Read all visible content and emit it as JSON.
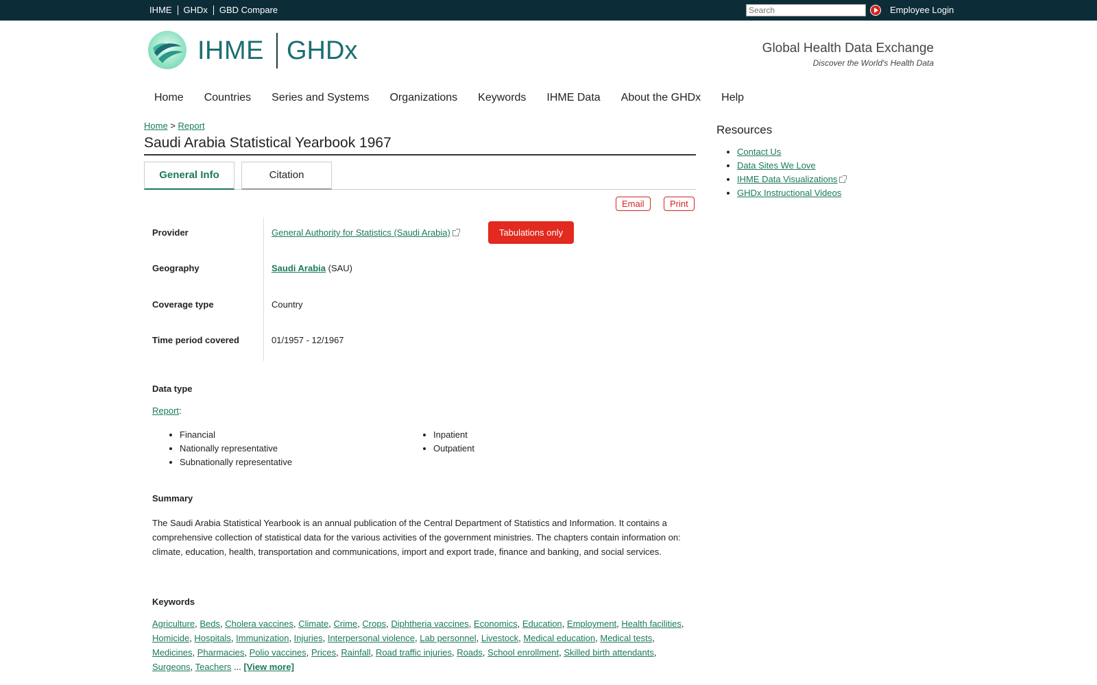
{
  "topbar": {
    "links": [
      "IHME",
      "GHDx",
      "GBD Compare"
    ],
    "search_placeholder": "Search",
    "login": "Employee Login"
  },
  "header": {
    "logo_ihme": "IHME",
    "logo_ghdx": "GHDx",
    "tagline_title": "Global Health Data Exchange",
    "tagline_sub": "Discover the World's Health Data"
  },
  "nav": [
    "Home",
    "Countries",
    "Series and Systems",
    "Organizations",
    "Keywords",
    "IHME Data",
    "About the GHDx",
    "Help"
  ],
  "breadcrumb": {
    "home": "Home",
    "sep": ">",
    "current": "Report"
  },
  "page_title": "Saudi Arabia Statistical Yearbook 1967",
  "tabs": {
    "general": "General Info",
    "citation": "Citation"
  },
  "actions": {
    "email": "Email",
    "print": "Print"
  },
  "details": {
    "provider_label": "Provider",
    "provider_value": "General Authority for Statistics (Saudi Arabia)",
    "tabulations": "Tabulations only",
    "geography_label": "Geography",
    "geography_value": "Saudi Arabia",
    "geography_code": "(SAU)",
    "coverage_label": "Coverage type",
    "coverage_value": "Country",
    "time_label": "Time period covered",
    "time_value": "01/1957 - 12/1967"
  },
  "data_type": {
    "label": "Data type",
    "link": "Report",
    "col1": [
      "Financial",
      "Nationally representative",
      "Subnationally representative"
    ],
    "col2": [
      "Inpatient",
      "Outpatient"
    ]
  },
  "summary": {
    "label": "Summary",
    "text": "The Saudi Arabia Statistical Yearbook is an annual publication of the Central Department of Statistics and Information. It contains a comprehensive collection of statistical data for the various activities of the government ministries. The chapters contain information on: climate, education, health, transportation and communications, import and export trade, finance and banking, and social services."
  },
  "keywords": {
    "label": "Keywords",
    "items": [
      "Agriculture",
      "Beds",
      "Cholera vaccines",
      "Climate",
      "Crime",
      "Crops",
      "Diphtheria vaccines",
      "Economics",
      "Education",
      "Employment",
      "Health facilities",
      "Homicide",
      "Hospitals",
      "Immunization",
      "Injuries",
      "Interpersonal violence",
      "Lab personnel",
      "Livestock",
      "Medical education",
      "Medical tests",
      "Medicines",
      "Pharmacies",
      "Polio vaccines",
      "Prices",
      "Rainfall",
      "Road traffic injuries",
      "Roads",
      "School enrollment",
      "Skilled birth attendants",
      "Surgeons",
      "Teachers"
    ],
    "ellipsis": "...",
    "view_more": "[View more]"
  },
  "sidebar": {
    "title": "Resources",
    "links": [
      "Contact Us",
      "Data Sites We Love",
      "IHME Data Visualizations",
      "GHDx Instructional Videos"
    ]
  },
  "colors": {
    "topbar": "#0c2d38",
    "link": "#1a7a5a",
    "accent_red": "#e22a1f"
  }
}
